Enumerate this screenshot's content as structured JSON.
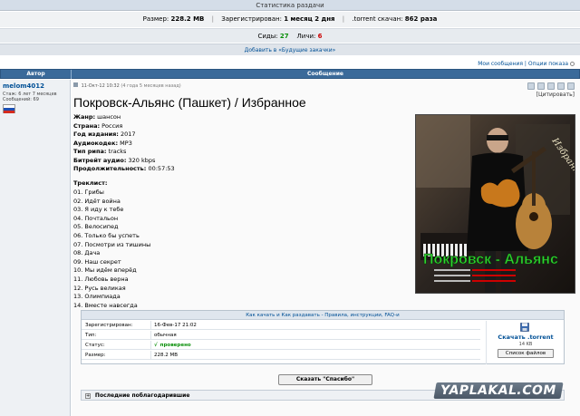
{
  "stats": {
    "title": "Статистика раздачи",
    "size_label": "Размер:",
    "size_value": "228.2 MB",
    "registered_label": "Зарегистрирован:",
    "registered_value": "1 месяц 2 дня",
    "downloaded_label": ".torrent скачан:",
    "downloaded_value": "862 раза",
    "seeds_label": "Сиды:",
    "seeds_value": "27",
    "leech_label": "Личи:",
    "leech_value": "6",
    "wishlist_label": "Добавить в «Будущие закачки»"
  },
  "top_links": {
    "my_messages": "Мои сообщения",
    "separator": "|",
    "view_options": "Опции показа"
  },
  "table": {
    "author_header": "Автор",
    "message_header": "Сообщение"
  },
  "author": {
    "name": "melom4012",
    "stage": "Стаж: 6 лет 7 месяцев",
    "messages": "Сообщений: 69"
  },
  "post": {
    "date": "11-Окт-12 10:32",
    "ago": "(4 года 5 месяцев назад)",
    "quote_label": "[Цитировать]",
    "title": "Покровск-Альянс (Пашкет) / Избранное",
    "meta": [
      {
        "label": "Жанр:",
        "value": "шансон"
      },
      {
        "label": "Страна:",
        "value": "Россия"
      },
      {
        "label": "Год издания:",
        "value": "2017"
      },
      {
        "label": "Аудиокодек:",
        "value": "MP3"
      },
      {
        "label": "Тип рипа:",
        "value": "tracks"
      },
      {
        "label": "Битрейт аудио:",
        "value": "320 kbps"
      },
      {
        "label": "Продолжительность:",
        "value": "00:57:53"
      }
    ],
    "tracklist_title": "Треклист:",
    "tracks": [
      "01. Грибы",
      "02. Идёт война",
      "03. Я иду к тебе",
      "04. Почтальон",
      "05. Велосипед",
      "06. Только бы успеть",
      "07. Посмотри из тишины",
      "08. Дача",
      "09. Наш секрет",
      "10. Мы идём вперёд",
      "11. Любовь верна",
      "12. Русь великая",
      "13. Олимпиада",
      "14. Вместе навсегда"
    ],
    "cover": {
      "corner_text": "Избранное",
      "band_text": "Покровск - Альянс"
    }
  },
  "torrent": {
    "help_text": "Как качать и Как раздавать - Правила, инструкции, FAQ-и",
    "rows": [
      {
        "label": "Зарегистрирован:",
        "value": "16-Фев-17 21:02"
      },
      {
        "label": "Тип:",
        "value": "обычная"
      },
      {
        "label": "Статус:",
        "value": "проверено"
      },
      {
        "label": "Размер:",
        "value": "228.2 MB"
      }
    ],
    "status_icon": "√",
    "download_label": "Скачать .torrent",
    "download_size": "14 KB",
    "files_button": "Список файлов"
  },
  "actions": {
    "thanks_button": "Сказать \"Спасибо\"",
    "last_thanks": "Последние поблагодарившие",
    "expand_icon": "+"
  },
  "watermark": "YAPLAKAL.COM",
  "colors": {
    "header_bg": "#3a6a9a",
    "link": "#005096",
    "seeds": "#0a8f0a",
    "leech": "#cc0000"
  }
}
